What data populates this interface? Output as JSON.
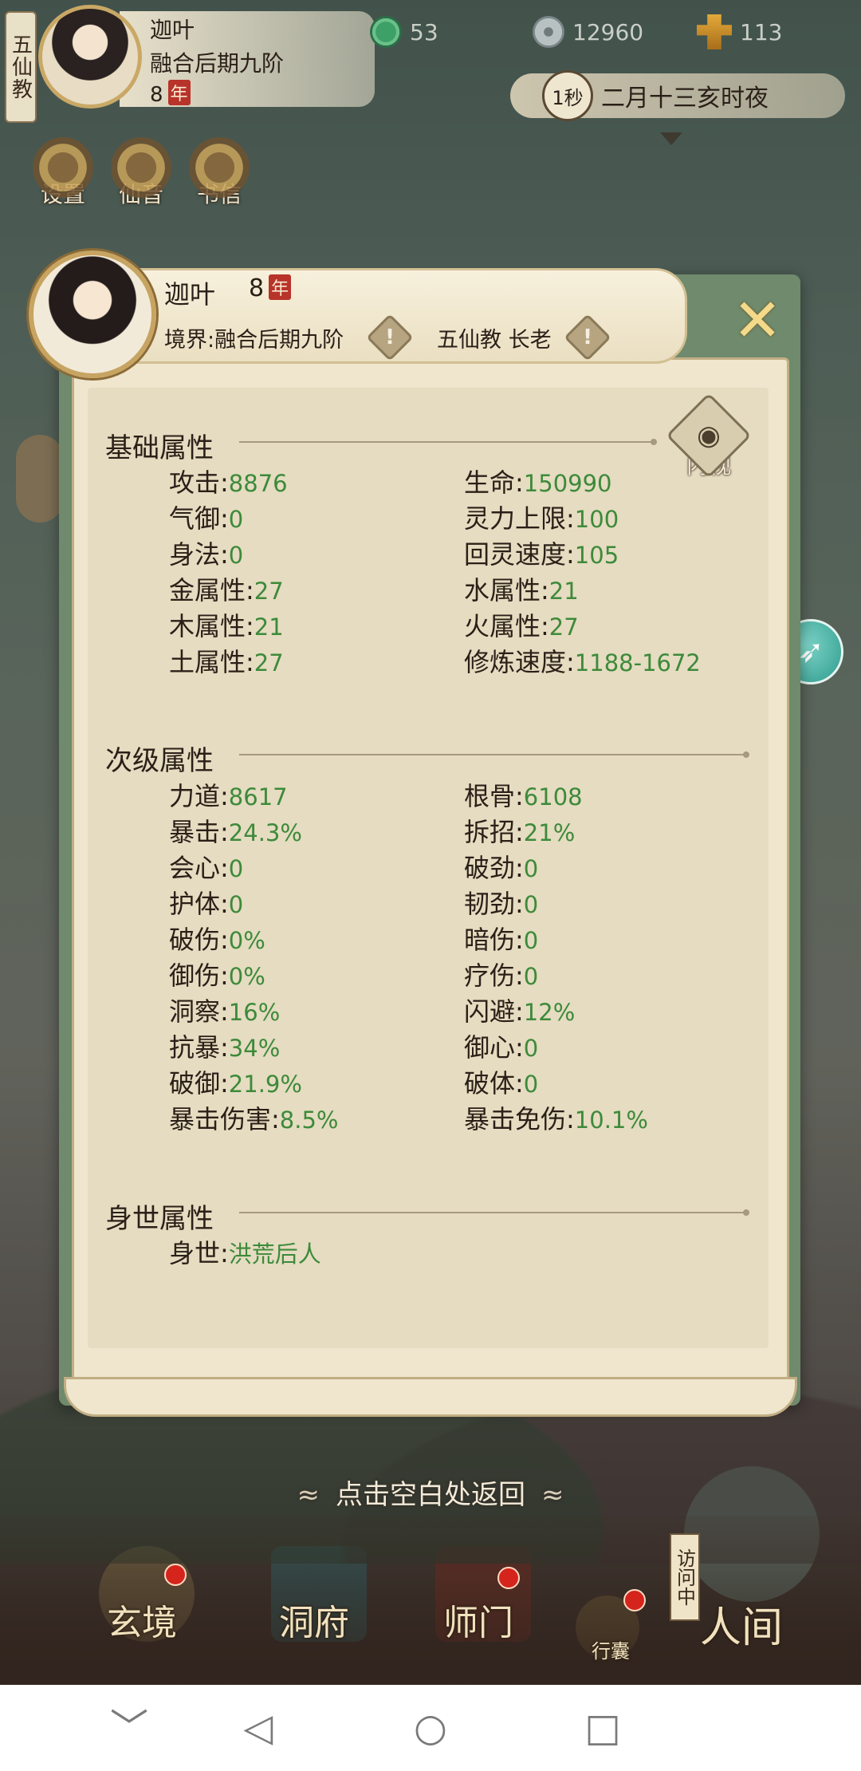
{
  "hud": {
    "sect": "五仙教",
    "name": "迦叶",
    "realm": "融合后期九阶",
    "age": "8",
    "age_unit": "年",
    "jade": "53",
    "coins": "12960",
    "gold": "113",
    "speed": "1秒",
    "datetime": "二月十三亥时夜"
  },
  "quick": {
    "settings": "设置",
    "music": "仙音",
    "letters": "书信"
  },
  "profile": {
    "name": "迦叶",
    "age": "8",
    "age_unit": "年",
    "realm_label": "境界:",
    "realm": "融合后期九阶",
    "sect": "五仙教 长老",
    "inspect_label": "内视",
    "close": "✕"
  },
  "sections": {
    "basic": "基础属性",
    "secondary": "次级属性",
    "origin": "身世属性"
  },
  "basic_stats": [
    {
      "label": "攻击",
      "value": "8876"
    },
    {
      "label": "生命",
      "value": "150990"
    },
    {
      "label": "气御",
      "value": "0"
    },
    {
      "label": "灵力上限",
      "value": "100"
    },
    {
      "label": "身法",
      "value": "0"
    },
    {
      "label": "回灵速度",
      "value": "105"
    },
    {
      "label": "金属性",
      "value": "27"
    },
    {
      "label": "水属性",
      "value": "21"
    },
    {
      "label": "木属性",
      "value": "21"
    },
    {
      "label": "火属性",
      "value": "27"
    },
    {
      "label": "土属性",
      "value": "27"
    },
    {
      "label": "修炼速度",
      "value": "1188-1672"
    }
  ],
  "secondary_stats": [
    {
      "label": "力道",
      "value": "8617"
    },
    {
      "label": "根骨",
      "value": "6108"
    },
    {
      "label": "暴击",
      "value": "24.3%"
    },
    {
      "label": "拆招",
      "value": "21%"
    },
    {
      "label": "会心",
      "value": "0"
    },
    {
      "label": "破劲",
      "value": "0"
    },
    {
      "label": "护体",
      "value": "0"
    },
    {
      "label": "韧劲",
      "value": "0"
    },
    {
      "label": "破伤",
      "value": "0%"
    },
    {
      "label": "暗伤",
      "value": "0"
    },
    {
      "label": "御伤",
      "value": "0%"
    },
    {
      "label": "疗伤",
      "value": "0"
    },
    {
      "label": "洞察",
      "value": "16%"
    },
    {
      "label": "闪避",
      "value": "12%"
    },
    {
      "label": "抗暴",
      "value": "34%"
    },
    {
      "label": "御心",
      "value": "0"
    },
    {
      "label": "破御",
      "value": "21.9%"
    },
    {
      "label": "破体",
      "value": "0"
    },
    {
      "label": "暴击伤害",
      "value": "8.5%"
    },
    {
      "label": "暴击免伤",
      "value": "10.1%"
    }
  ],
  "origin_stats": [
    {
      "label": "身世",
      "value": "洪荒后人"
    }
  ],
  "return_hint": "点击空白处返回",
  "nav": {
    "realm": "玄境",
    "cave": "洞府",
    "sect": "师门",
    "bag": "行囊",
    "world": "人间",
    "visiting": "访问中"
  },
  "system": {
    "down": "﹀",
    "back": "◁",
    "home": "○",
    "recent": "□"
  }
}
